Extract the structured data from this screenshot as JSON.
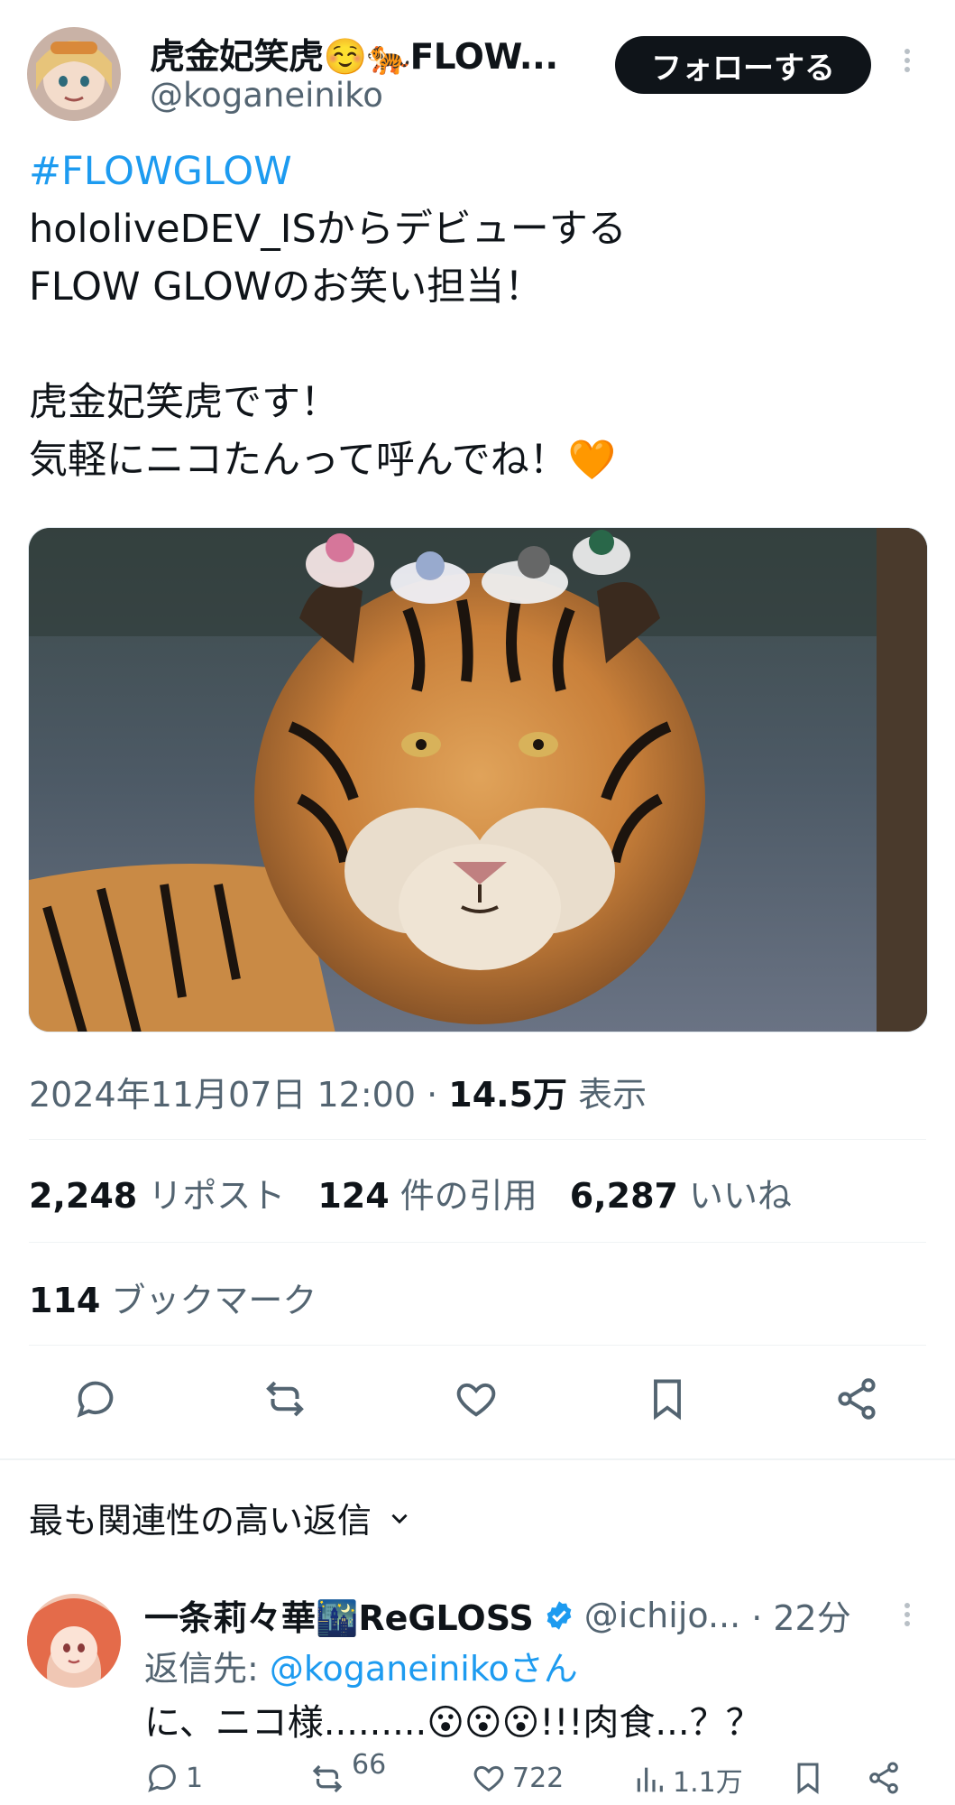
{
  "author": {
    "name": "虎金妃笑虎☺️🐅FLOW...",
    "handle": "@koganeiniko",
    "follow_label": "フォローする"
  },
  "tweet": {
    "lines": [
      "#FLOWGLOW",
      "hololiveDEV_ISからデビューする",
      "FLOW GLOWのお笑い担当！",
      "",
      "虎金妃笑虎です！",
      "気軽にニコたんって呼んでね！🧡"
    ],
    "datetime": "2024年11月07日 12:00",
    "separator": "·",
    "views_count": "14.5万",
    "views_label": "表示"
  },
  "stats": {
    "reposts_count": "2,248",
    "reposts_label": "リポスト",
    "quotes_count": "124",
    "quotes_label": "件の引用",
    "likes_count": "6,287",
    "likes_label": "いいね",
    "bookmarks_count": "114",
    "bookmarks_label": "ブックマーク"
  },
  "replies_sort": {
    "label": "最も関連性の高い返信"
  },
  "reply": {
    "name": "一条莉々華🌃ReGLOSS",
    "handle": "@ichijo...",
    "time": "· 22分",
    "reply_to_prefix": "返信先: ",
    "reply_to_mention": "@koganeinikoさん",
    "text": "に、ニコ様.........😮😮😮!!!肉食...？？",
    "replies": "1",
    "reposts": "66",
    "likes": "722",
    "views": "1.1万"
  },
  "colors": {
    "link": "#1d9bf0",
    "secondary": "#536471",
    "primary_text": "#0f1419"
  }
}
